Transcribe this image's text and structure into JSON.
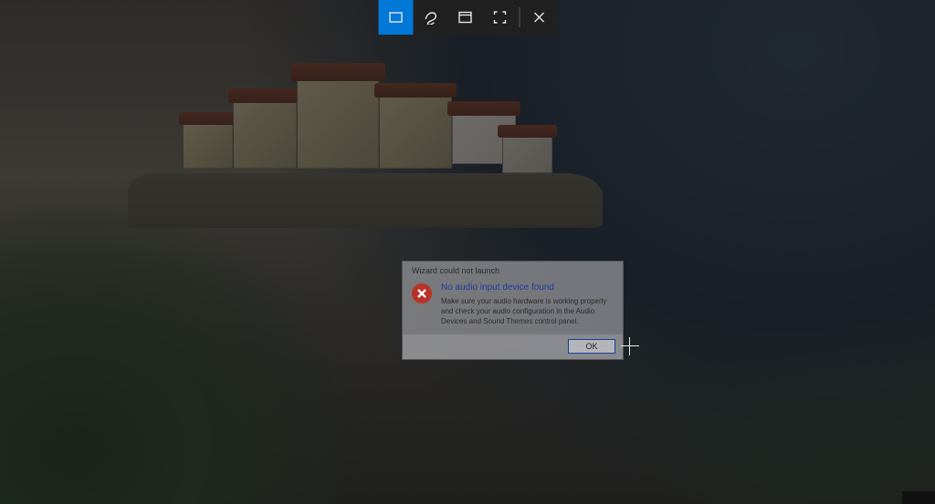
{
  "snip_toolbar": {
    "buttons": [
      {
        "name": "rectangular-snip",
        "active": true
      },
      {
        "name": "freeform-snip",
        "active": false
      },
      {
        "name": "window-snip",
        "active": false
      },
      {
        "name": "fullscreen-snip",
        "active": false
      }
    ],
    "close_name": "close"
  },
  "dialog": {
    "title": "Wizard could not launch",
    "heading": "No audio input device found",
    "body": "Make sure your audio hardware is working properly and check your audio configuration in the Audio Devices and Sound Themes control panel.",
    "ok_label": "OK"
  }
}
